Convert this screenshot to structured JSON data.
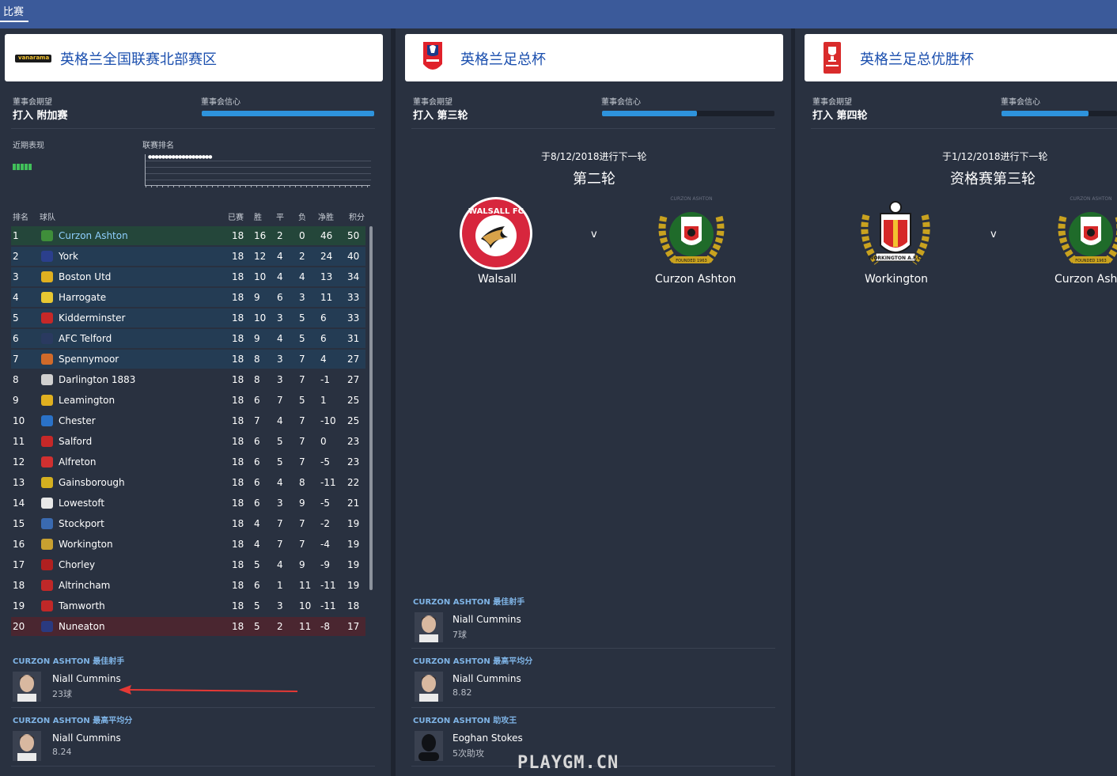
{
  "topbar": {
    "tab_label": "比赛"
  },
  "league": {
    "title": "英格兰全国联赛北部赛区",
    "logo_text": "vanarama",
    "board_expectation_label": "董事会期望",
    "board_expectation_value": "打入 附加赛",
    "board_confidence_label": "董事会信心",
    "board_confidence_level": 1.0,
    "recent_form_label": "近期表现",
    "league_position_label": "联赛排名",
    "table_headers": {
      "pos": "排名",
      "team": "球队",
      "played": "已赛",
      "won": "胜",
      "drawn": "平",
      "lost": "负",
      "gd": "净胜",
      "points": "积分"
    },
    "rows": [
      {
        "pos": "1",
        "team": "Curzon Ashton",
        "p": "18",
        "w": "16",
        "d": "2",
        "l": "0",
        "gd": "46",
        "pts": "50",
        "zone": "champion",
        "crest": "#3f8e3a"
      },
      {
        "pos": "2",
        "team": "York",
        "p": "18",
        "w": "12",
        "d": "4",
        "l": "2",
        "gd": "24",
        "pts": "40",
        "zone": "playoff",
        "crest": "#2b3f8c"
      },
      {
        "pos": "3",
        "team": "Boston Utd",
        "p": "18",
        "w": "10",
        "d": "4",
        "l": "4",
        "gd": "13",
        "pts": "34",
        "zone": "playoff",
        "crest": "#e0b020"
      },
      {
        "pos": "4",
        "team": "Harrogate",
        "p": "18",
        "w": "9",
        "d": "6",
        "l": "3",
        "gd": "11",
        "pts": "33",
        "zone": "playoff",
        "crest": "#e8c832"
      },
      {
        "pos": "5",
        "team": "Kidderminster",
        "p": "18",
        "w": "10",
        "d": "3",
        "l": "5",
        "gd": "6",
        "pts": "33",
        "zone": "playoff",
        "crest": "#c62828"
      },
      {
        "pos": "6",
        "team": "AFC Telford",
        "p": "18",
        "w": "9",
        "d": "4",
        "l": "5",
        "gd": "6",
        "pts": "31",
        "zone": "playoff",
        "crest": "#2a3a60"
      },
      {
        "pos": "7",
        "team": "Spennymoor",
        "p": "18",
        "w": "8",
        "d": "3",
        "l": "7",
        "gd": "4",
        "pts": "27",
        "zone": "playoff",
        "crest": "#d06a2a"
      },
      {
        "pos": "8",
        "team": "Darlington 1883",
        "p": "18",
        "w": "8",
        "d": "3",
        "l": "7",
        "gd": "-1",
        "pts": "27",
        "zone": "",
        "crest": "#d0d0d0"
      },
      {
        "pos": "9",
        "team": "Leamington",
        "p": "18",
        "w": "6",
        "d": "7",
        "l": "5",
        "gd": "1",
        "pts": "25",
        "zone": "",
        "crest": "#e0b020"
      },
      {
        "pos": "10",
        "team": "Chester",
        "p": "18",
        "w": "7",
        "d": "4",
        "l": "7",
        "gd": "-10",
        "pts": "25",
        "zone": "",
        "crest": "#2a72c8"
      },
      {
        "pos": "11",
        "team": "Salford",
        "p": "18",
        "w": "6",
        "d": "5",
        "l": "7",
        "gd": "0",
        "pts": "23",
        "zone": "",
        "crest": "#c62828"
      },
      {
        "pos": "12",
        "team": "Alfreton",
        "p": "18",
        "w": "6",
        "d": "5",
        "l": "7",
        "gd": "-5",
        "pts": "23",
        "zone": "",
        "crest": "#d03030"
      },
      {
        "pos": "13",
        "team": "Gainsborough",
        "p": "18",
        "w": "6",
        "d": "4",
        "l": "8",
        "gd": "-11",
        "pts": "22",
        "zone": "",
        "crest": "#d4b020"
      },
      {
        "pos": "14",
        "team": "Lowestoft",
        "p": "18",
        "w": "6",
        "d": "3",
        "l": "9",
        "gd": "-5",
        "pts": "21",
        "zone": "",
        "crest": "#e8e8e8"
      },
      {
        "pos": "15",
        "team": "Stockport",
        "p": "18",
        "w": "4",
        "d": "7",
        "l": "7",
        "gd": "-2",
        "pts": "19",
        "zone": "",
        "crest": "#3a6ab0"
      },
      {
        "pos": "16",
        "team": "Workington",
        "p": "18",
        "w": "4",
        "d": "7",
        "l": "7",
        "gd": "-4",
        "pts": "19",
        "zone": "",
        "crest": "#c8a030"
      },
      {
        "pos": "17",
        "team": "Chorley",
        "p": "18",
        "w": "5",
        "d": "4",
        "l": "9",
        "gd": "-9",
        "pts": "19",
        "zone": "",
        "crest": "#b02020"
      },
      {
        "pos": "18",
        "team": "Altrincham",
        "p": "18",
        "w": "6",
        "d": "1",
        "l": "11",
        "gd": "-11",
        "pts": "19",
        "zone": "",
        "crest": "#c02828"
      },
      {
        "pos": "19",
        "team": "Tamworth",
        "p": "18",
        "w": "5",
        "d": "3",
        "l": "10",
        "gd": "-11",
        "pts": "18",
        "zone": "",
        "crest": "#c02828"
      },
      {
        "pos": "20",
        "team": "Nuneaton",
        "p": "18",
        "w": "5",
        "d": "2",
        "l": "11",
        "gd": "-8",
        "pts": "17",
        "zone": "relegation",
        "crest": "#2a3a80"
      }
    ],
    "stats": [
      {
        "label": "CURZON ASHTON 最佳射手",
        "player": "Niall Cummins",
        "value": "23球"
      },
      {
        "label": "CURZON ASHTON 最高平均分",
        "player": "Niall Cummins",
        "value": "8.24"
      }
    ]
  },
  "facup": {
    "title": "英格兰足总杯",
    "logo_text": "The Emirates FA Cup",
    "board_expectation_label": "董事会期望",
    "board_expectation_value": "打入 第三轮",
    "board_confidence_label": "董事会信心",
    "board_confidence_level": 0.55,
    "next_round_date": "于8/12/2018进行下一轮",
    "round_name": "第二轮",
    "home_team": "Walsall",
    "away_team": "Curzon Ashton",
    "vs": "v",
    "walsall_badge_text": "WALSALL FC",
    "curzon_badge_top": "CURZON ASHTON",
    "curzon_badge_bottom": "FOUNDED 1963",
    "stats": [
      {
        "label": "CURZON ASHTON 最佳射手",
        "player": "Niall Cummins",
        "value": "7球"
      },
      {
        "label": "CURZON ASHTON 最高平均分",
        "player": "Niall Cummins",
        "value": "8.82"
      },
      {
        "label": "CURZON ASHTON 助攻王",
        "player": "Eoghan Stokes",
        "value": "5次助攻"
      }
    ]
  },
  "fatrophy": {
    "title": "英格兰足总优胜杯",
    "logo_text": "The Buildbase FA Trophy",
    "board_expectation_label": "董事会期望",
    "board_expectation_value": "打入 第四轮",
    "board_confidence_label": "董事会信心",
    "board_confidence_level": 0.75,
    "next_round_date": "于1/12/2018进行下一轮",
    "round_name": "资格赛第三轮",
    "home_team": "Workington",
    "away_team": "Curzon Ashton",
    "vs": "v",
    "workington_badge_text": "WORKINGTON A.F.C.",
    "curzon_badge_top": "CURZON ASHTON",
    "curzon_badge_bottom": "FOUNDED 1963"
  },
  "watermark": "PLAYGM.CN",
  "colors": {
    "accent_blue": "#2e93dc",
    "champion_row": "#24463a",
    "playoff_row": "#243c54",
    "relegation_row": "#4a2630",
    "form_win": "#41c05a",
    "arrow": "#e53935"
  }
}
